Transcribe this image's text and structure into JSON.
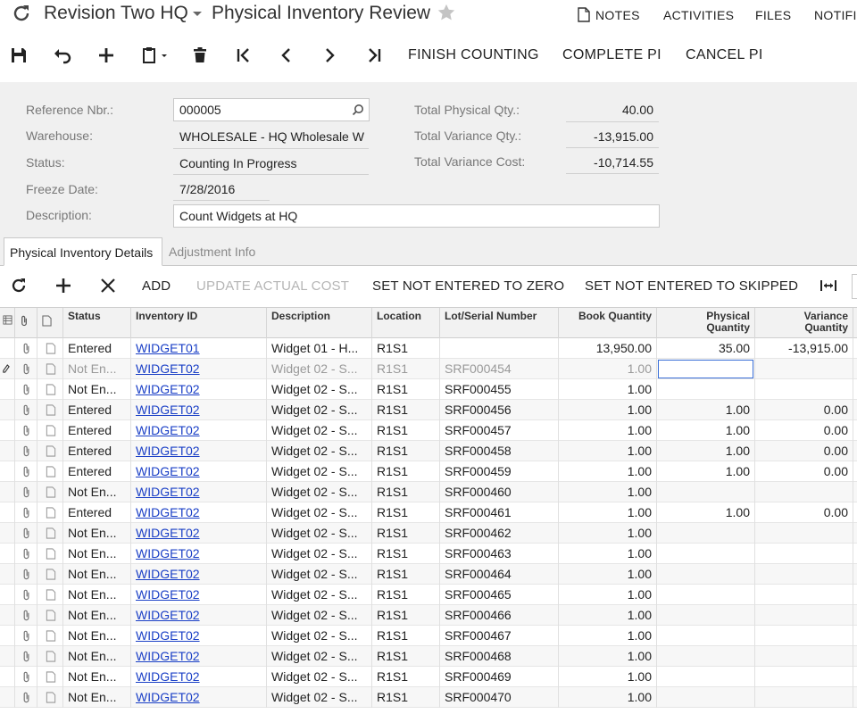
{
  "header": {
    "company": "Revision Two HQ",
    "screen_title": "Physical Inventory Review",
    "links": {
      "notes": "NOTES",
      "activities": "ACTIVITIES",
      "files": "FILES",
      "notifications": "NOTIFIC"
    }
  },
  "toolbar": {
    "icons": [
      "save-icon",
      "undo-icon",
      "add-icon",
      "clipboard-icon",
      "delete-icon",
      "first-icon",
      "prev-icon",
      "next-icon",
      "last-icon"
    ],
    "actions": {
      "finish_counting": "FINISH COUNTING",
      "complete_pi": "COMPLETE PI",
      "cancel_pi": "CANCEL PI"
    }
  },
  "form": {
    "reference_nbr": {
      "label": "Reference Nbr.:",
      "value": "000005"
    },
    "warehouse": {
      "label": "Warehouse:",
      "value": "WHOLESALE - HQ Wholesale W"
    },
    "status": {
      "label": "Status:",
      "value": "Counting In Progress"
    },
    "freeze_date": {
      "label": "Freeze Date:",
      "value": "7/28/2016"
    },
    "description": {
      "label": "Description:",
      "value": "Count Widgets at HQ"
    },
    "total_physical_qty": {
      "label": "Total Physical Qty.:",
      "value": "40.00"
    },
    "total_variance_qty": {
      "label": "Total Variance Qty.:",
      "value": "-13,915.00"
    },
    "total_variance_cost": {
      "label": "Total Variance Cost:",
      "value": "-10,714.55"
    }
  },
  "tabs": [
    {
      "label": "Physical Inventory Details",
      "active": true
    },
    {
      "label": "Adjustment Info",
      "active": false
    }
  ],
  "grid_toolbar": {
    "add": "ADD",
    "update_actual_cost": "UPDATE ACTUAL COST",
    "set_not_entered_zero": "SET NOT ENTERED TO ZERO",
    "set_not_entered_skipped": "SET NOT ENTERED TO SKIPPED"
  },
  "grid": {
    "columns": {
      "status": "Status",
      "inventory_id": "Inventory ID",
      "description": "Description",
      "location": "Location",
      "lot_serial": "Lot/Serial Number",
      "book_qty": "Book Quantity",
      "physical_qty_1": "Physical",
      "physical_qty_2": "Quantity",
      "variance_qty_1": "Variance",
      "variance_qty_2": "Quantity"
    },
    "rows": [
      {
        "status": "Entered",
        "inventory_id": "WIDGET01",
        "description": "Widget 01 - H...",
        "location": "R1S1",
        "lot": "",
        "book": "13,950.00",
        "physical": "35.00",
        "variance": "-13,915.00"
      },
      {
        "status": "Not En...",
        "inventory_id": "WIDGET02",
        "description": "Widget 02 - S...",
        "location": "R1S1",
        "lot": "SRF000454",
        "book": "1.00",
        "physical": "",
        "variance": ""
      },
      {
        "status": "Not En...",
        "inventory_id": "WIDGET02",
        "description": "Widget 02 - S...",
        "location": "R1S1",
        "lot": "SRF000455",
        "book": "1.00",
        "physical": "",
        "variance": ""
      },
      {
        "status": "Entered",
        "inventory_id": "WIDGET02",
        "description": "Widget 02 - S...",
        "location": "R1S1",
        "lot": "SRF000456",
        "book": "1.00",
        "physical": "1.00",
        "variance": "0.00"
      },
      {
        "status": "Entered",
        "inventory_id": "WIDGET02",
        "description": "Widget 02 - S...",
        "location": "R1S1",
        "lot": "SRF000457",
        "book": "1.00",
        "physical": "1.00",
        "variance": "0.00"
      },
      {
        "status": "Entered",
        "inventory_id": "WIDGET02",
        "description": "Widget 02 - S...",
        "location": "R1S1",
        "lot": "SRF000458",
        "book": "1.00",
        "physical": "1.00",
        "variance": "0.00"
      },
      {
        "status": "Entered",
        "inventory_id": "WIDGET02",
        "description": "Widget 02 - S...",
        "location": "R1S1",
        "lot": "SRF000459",
        "book": "1.00",
        "physical": "1.00",
        "variance": "0.00"
      },
      {
        "status": "Not En...",
        "inventory_id": "WIDGET02",
        "description": "Widget 02 - S...",
        "location": "R1S1",
        "lot": "SRF000460",
        "book": "1.00",
        "physical": "",
        "variance": ""
      },
      {
        "status": "Entered",
        "inventory_id": "WIDGET02",
        "description": "Widget 02 - S...",
        "location": "R1S1",
        "lot": "SRF000461",
        "book": "1.00",
        "physical": "1.00",
        "variance": "0.00"
      },
      {
        "status": "Not En...",
        "inventory_id": "WIDGET02",
        "description": "Widget 02 - S...",
        "location": "R1S1",
        "lot": "SRF000462",
        "book": "1.00",
        "physical": "",
        "variance": ""
      },
      {
        "status": "Not En...",
        "inventory_id": "WIDGET02",
        "description": "Widget 02 - S...",
        "location": "R1S1",
        "lot": "SRF000463",
        "book": "1.00",
        "physical": "",
        "variance": ""
      },
      {
        "status": "Not En...",
        "inventory_id": "WIDGET02",
        "description": "Widget 02 - S...",
        "location": "R1S1",
        "lot": "SRF000464",
        "book": "1.00",
        "physical": "",
        "variance": ""
      },
      {
        "status": "Not En...",
        "inventory_id": "WIDGET02",
        "description": "Widget 02 - S...",
        "location": "R1S1",
        "lot": "SRF000465",
        "book": "1.00",
        "physical": "",
        "variance": ""
      },
      {
        "status": "Not En...",
        "inventory_id": "WIDGET02",
        "description": "Widget 02 - S...",
        "location": "R1S1",
        "lot": "SRF000466",
        "book": "1.00",
        "physical": "",
        "variance": ""
      },
      {
        "status": "Not En...",
        "inventory_id": "WIDGET02",
        "description": "Widget 02 - S...",
        "location": "R1S1",
        "lot": "SRF000467",
        "book": "1.00",
        "physical": "",
        "variance": ""
      },
      {
        "status": "Not En...",
        "inventory_id": "WIDGET02",
        "description": "Widget 02 - S...",
        "location": "R1S1",
        "lot": "SRF000468",
        "book": "1.00",
        "physical": "",
        "variance": ""
      },
      {
        "status": "Not En...",
        "inventory_id": "WIDGET02",
        "description": "Widget 02 - S...",
        "location": "R1S1",
        "lot": "SRF000469",
        "book": "1.00",
        "physical": "",
        "variance": ""
      },
      {
        "status": "Not En...",
        "inventory_id": "WIDGET02",
        "description": "Widget 02 - S...",
        "location": "R1S1",
        "lot": "SRF000470",
        "book": "1.00",
        "physical": "",
        "variance": ""
      }
    ],
    "editing_row": 1
  },
  "colors": {
    "link": "#1a3fc6",
    "form_bg": "#f0f0f0",
    "focus": "#3a6fd8"
  }
}
